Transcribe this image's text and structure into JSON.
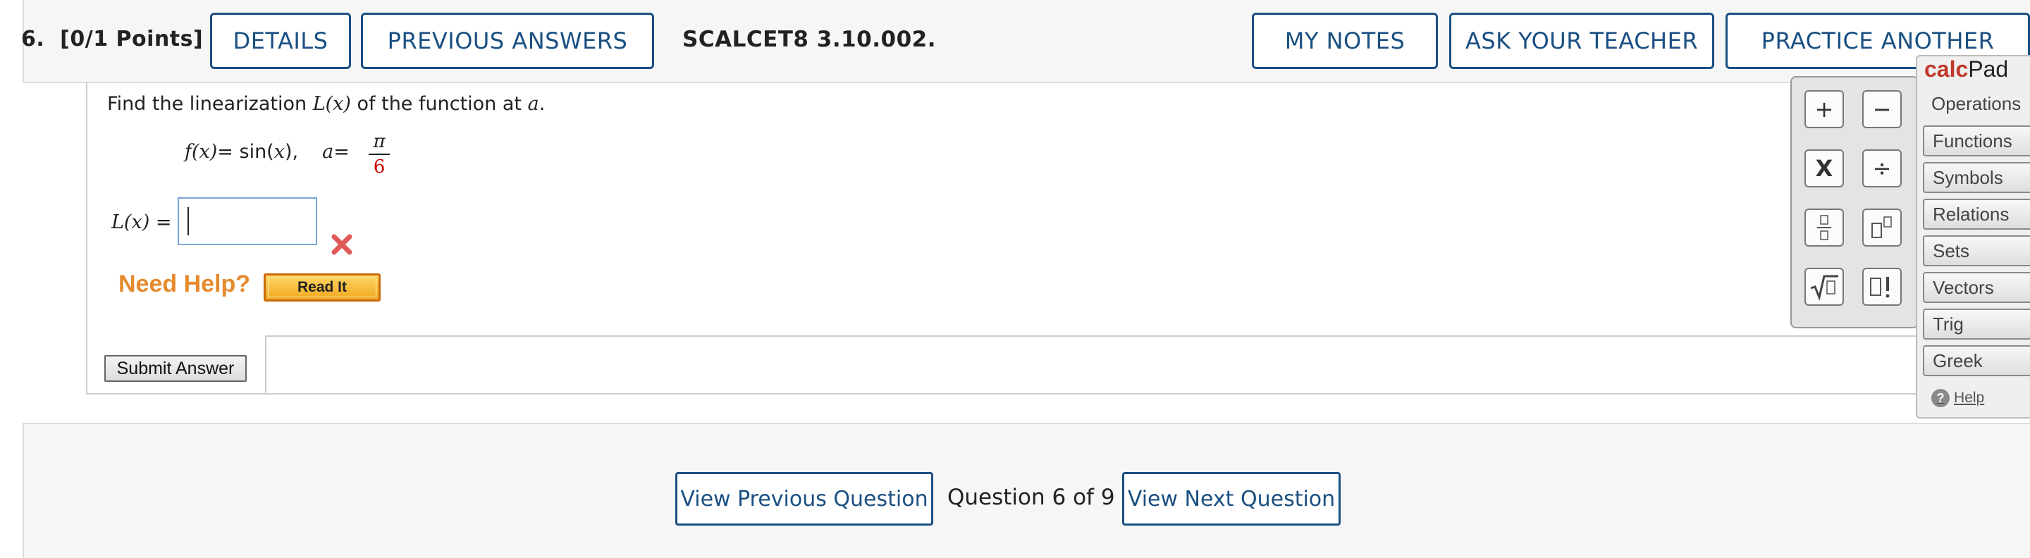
{
  "header": {
    "question_number": "6.",
    "points": "[0/1 Points]",
    "details_label": "DETAILS",
    "previous_answers_label": "PREVIOUS ANSWERS",
    "question_code": "SCALCET8 3.10.002.",
    "my_notes_label": "MY NOTES",
    "ask_teacher_label": "ASK YOUR TEACHER",
    "practice_another_label": "PRACTICE ANOTHER"
  },
  "question": {
    "prompt_before": "Find the linearization ",
    "prompt_lx": "L(x)",
    "prompt_middle": " of the function at ",
    "prompt_a": "a",
    "prompt_end": ".",
    "function_lhs": "f(x)",
    "function_eq": " = sin(",
    "function_x": "x",
    "function_close": "),",
    "a_label": "a",
    "a_eq": " = ",
    "a_numerator": "π",
    "a_denominator": "6",
    "answer_label": "L(x)",
    "answer_eq": " =",
    "answer_value": "",
    "status": "incorrect"
  },
  "help": {
    "need_help_label": "Need Help?",
    "read_it_label": "Read It"
  },
  "submit_label": "Submit Answer",
  "navigation": {
    "previous_label": "View Previous Question",
    "counter": "Question 6 of 9",
    "next_label": "View Next Question"
  },
  "calcpad": {
    "title_part1": "calc",
    "title_part2": "Pad",
    "operations_label": "Operations",
    "keys": [
      "+",
      "−",
      "X",
      "÷",
      "▯/▯",
      "▯^▯",
      "√▯",
      "▯!"
    ],
    "tabs": [
      "Functions",
      "Symbols",
      "Relations",
      "Sets",
      "Vectors",
      "Trig",
      "Greek"
    ],
    "help_label": "Help"
  },
  "colors": {
    "accent_blue": "#1a4f82",
    "need_help_orange": "#e68a2e",
    "wrong_red": "#e05a5a",
    "denominator_red": "#cc0000"
  }
}
